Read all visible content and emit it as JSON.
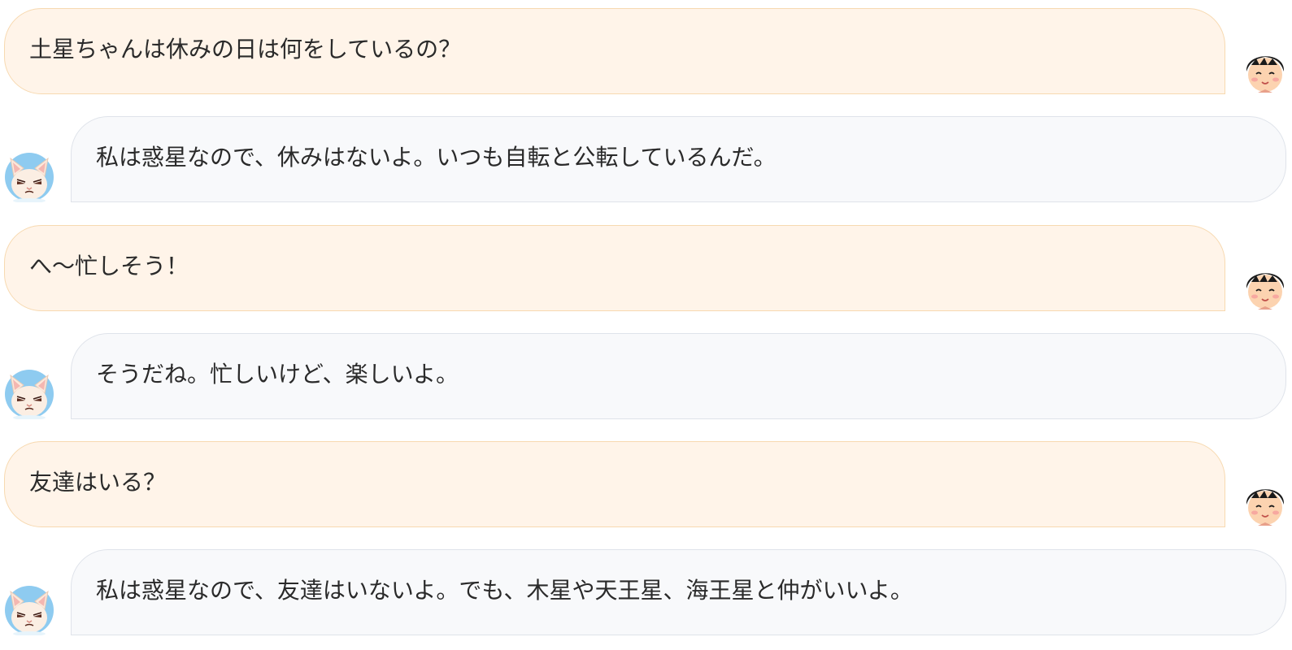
{
  "messages": [
    {
      "role": "user",
      "text": "土星ちゃんは休みの日は何をしているの？"
    },
    {
      "role": "bot",
      "text": "私は惑星なので、休みはないよ。いつも自転と公転しているんだ。"
    },
    {
      "role": "user",
      "text": "へ〜忙しそう！"
    },
    {
      "role": "bot",
      "text": "そうだね。忙しいけど、楽しいよ。"
    },
    {
      "role": "user",
      "text": "友達はいる？"
    },
    {
      "role": "bot",
      "text": "私は惑星なので、友達はいないよ。でも、木星や天王星、海王星と仲がいいよ。"
    }
  ],
  "avatars": {
    "user": "boy-avatar-icon",
    "bot": "cat-avatar-icon"
  },
  "colors": {
    "user_bubble_bg": "#fff4e9",
    "user_bubble_border": "#f7d9b0",
    "bot_bubble_bg": "#f8f9fb",
    "bot_bubble_border": "#dfe3ea",
    "text": "#2a2a2a"
  }
}
